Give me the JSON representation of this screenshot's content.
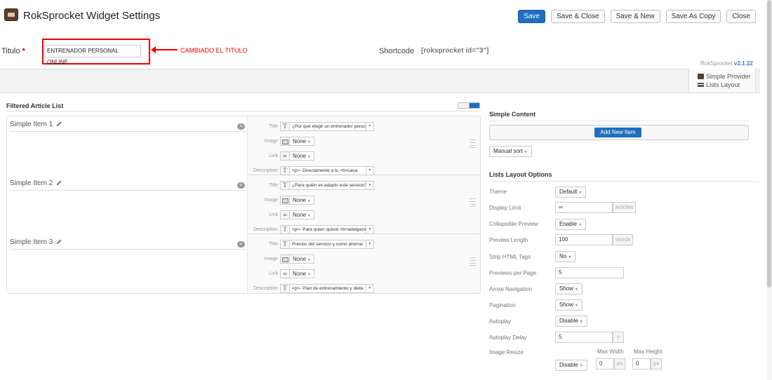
{
  "header": {
    "title": "RokSprocket Widget Settings",
    "buttons": [
      "Save",
      "Save & Close",
      "Save & New",
      "Save As Copy",
      "Close"
    ]
  },
  "title_field": {
    "label": "Titulo",
    "required_mark": "*",
    "value": "ENTRENADOR PERSONAL ONLINE",
    "annotation": "CAMBIADO EL TITULO"
  },
  "shortcode": {
    "label": "Shortcode",
    "value": "[roksprocket id=\"3\"]"
  },
  "version": {
    "name": "RokSprocket",
    "number": "v2.1.22"
  },
  "provider_tabs": [
    "Simple Provider",
    "Lists Layout"
  ],
  "article_list": {
    "title": "Filtered Article List",
    "field_labels": {
      "title": "Title",
      "image": "Image",
      "link": "Link",
      "description": "Description"
    },
    "items": [
      {
        "name": "Simple Item 1",
        "title": "¿Por qué elegir un entrenador personal online?",
        "image": "None",
        "link": "None",
        "description": "<p>- Directamente a tu <b>casa"
      },
      {
        "name": "Simple Item 2",
        "title": "¿Para quién es adapto este servicio?",
        "image": "None",
        "link": "None",
        "description": "<p>- Para quien quiere <b>adelgazar"
      },
      {
        "name": "Simple Item 3",
        "title": "Precios del servicio y como ahorrar",
        "image": "None",
        "link": "None",
        "description": "<p>- Plan de entrenamiento y dieta"
      }
    ]
  },
  "simple_content": {
    "title": "Simple Content",
    "add_button": "Add New Item",
    "sort": "Manual sort"
  },
  "layout_options": {
    "title": "Lists Layout Options",
    "theme": {
      "label": "Theme",
      "value": "Default"
    },
    "display_limit": {
      "label": "Display Limit",
      "value": "∞",
      "unit": "articles"
    },
    "collapsible_preview": {
      "label": "Collapsible Preview",
      "value": "Enable"
    },
    "preview_length": {
      "label": "Preview Length",
      "value": "100",
      "unit": "words"
    },
    "strip_html": {
      "label": "Strip HTML Tags",
      "value": "No"
    },
    "previews_per_page": {
      "label": "Previews per Page",
      "value": "5"
    },
    "arrow_navigation": {
      "label": "Arrow Navigation",
      "value": "Show"
    },
    "pagination": {
      "label": "Pagination",
      "value": "Show"
    },
    "autoplay": {
      "label": "Autoplay",
      "value": "Disable"
    },
    "autoplay_delay": {
      "label": "Autoplay Delay",
      "value": "5",
      "unit": "s"
    },
    "image_resize": {
      "label": "Image Resize",
      "value": "Disable",
      "max_width_label": "Max Width",
      "max_height_label": "Max Height",
      "max_width": "0",
      "max_height": "0",
      "unit": "px"
    }
  }
}
